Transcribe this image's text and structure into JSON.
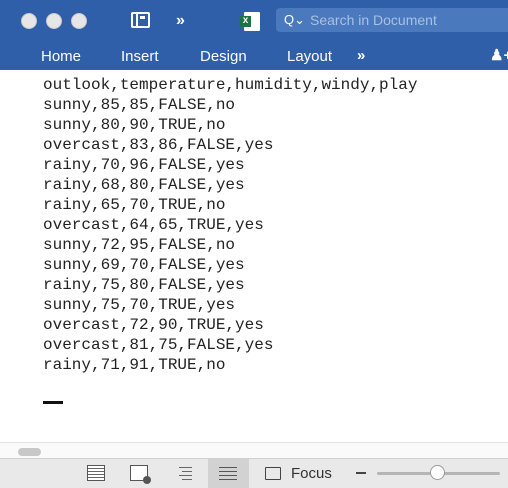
{
  "toolbar": {
    "more_label": "»",
    "search_placeholder": "Search in Document",
    "search_icon_glyph": "Q⌄"
  },
  "ribbon": {
    "tabs": [
      "Home",
      "Insert",
      "Design",
      "Layout"
    ],
    "more_label": "»",
    "share_glyph": "♟+"
  },
  "document": {
    "lines": [
      "outlook,temperature,humidity,windy,play",
      "sunny,85,85,FALSE,no",
      "sunny,80,90,TRUE,no",
      "overcast,83,86,FALSE,yes",
      "rainy,70,96,FALSE,yes",
      "rainy,68,80,FALSE,yes",
      "rainy,65,70,TRUE,no",
      "overcast,64,65,TRUE,yes",
      "sunny,72,95,FALSE,no",
      "sunny,69,70,FALSE,yes",
      "rainy,75,80,FALSE,yes",
      "sunny,75,70,TRUE,yes",
      "overcast,72,90,TRUE,yes",
      "overcast,81,75,FALSE,yes",
      "rainy,71,91,TRUE,no"
    ]
  },
  "statusbar": {
    "focus_label": "Focus",
    "zoom_fraction": 0.49
  },
  "colors": {
    "accent": "#2e5fa8"
  }
}
